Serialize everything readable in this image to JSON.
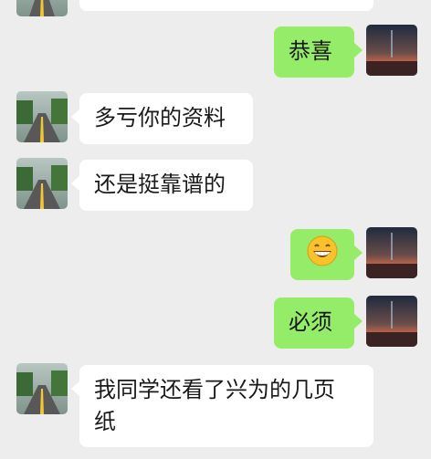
{
  "chat": {
    "messages": [
      {
        "side": "in",
        "text": ""
      },
      {
        "side": "out",
        "text": "恭喜"
      },
      {
        "side": "in",
        "text": "多亏你的资料"
      },
      {
        "side": "in",
        "text": "还是挺靠谱的"
      },
      {
        "side": "out",
        "emoji": "grinning-face-emoji"
      },
      {
        "side": "out",
        "text": "必须"
      },
      {
        "side": "in",
        "text_line1": "我同学还看了兴为的几页",
        "text_line2": "纸"
      }
    ]
  },
  "avatars": {
    "contact": "road-landscape-avatar",
    "self": "sunset-lake-avatar"
  },
  "colors": {
    "background": "#ededed",
    "incoming_bubble": "#ffffff",
    "outgoing_bubble": "#95ec69"
  }
}
